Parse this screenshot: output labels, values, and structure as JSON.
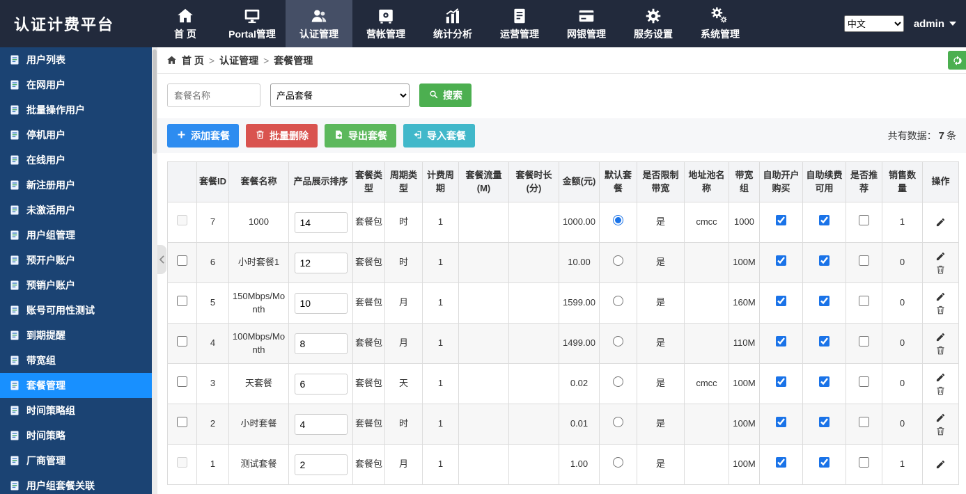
{
  "app": {
    "logo": "认证计费平台"
  },
  "topnav": {
    "items": [
      {
        "label": "首 页",
        "icon": "home-icon",
        "active": false
      },
      {
        "label": "Portal管理",
        "icon": "monitor-icon",
        "active": false
      },
      {
        "label": "认证管理",
        "icon": "users-icon",
        "active": true
      },
      {
        "label": "营帐管理",
        "icon": "safe-icon",
        "active": false
      },
      {
        "label": "统计分析",
        "icon": "chart-icon",
        "active": false
      },
      {
        "label": "运营管理",
        "icon": "ledger-icon",
        "active": false
      },
      {
        "label": "网银管理",
        "icon": "bankcard-icon",
        "active": false
      },
      {
        "label": "服务设置",
        "icon": "gear-icon",
        "active": false
      },
      {
        "label": "系统管理",
        "icon": "cogs-icon",
        "active": false
      }
    ],
    "language_selected": "中文",
    "username": "admin"
  },
  "sidebar": {
    "items": [
      {
        "label": "用户列表",
        "active": false
      },
      {
        "label": "在网用户",
        "active": false
      },
      {
        "label": "批量操作用户",
        "active": false
      },
      {
        "label": "停机用户",
        "active": false
      },
      {
        "label": "在线用户",
        "active": false
      },
      {
        "label": "新注册用户",
        "active": false
      },
      {
        "label": "未激活用户",
        "active": false
      },
      {
        "label": "用户组管理",
        "active": false
      },
      {
        "label": "预开户账户",
        "active": false
      },
      {
        "label": "预销户账户",
        "active": false
      },
      {
        "label": "账号可用性测试",
        "active": false
      },
      {
        "label": "到期提醒",
        "active": false
      },
      {
        "label": "带宽组",
        "active": false
      },
      {
        "label": "套餐管理",
        "active": true
      },
      {
        "label": "时间策略组",
        "active": false
      },
      {
        "label": "时间策略",
        "active": false
      },
      {
        "label": "厂商管理",
        "active": false
      },
      {
        "label": "用户组套餐关联",
        "active": false
      }
    ]
  },
  "breadcrumb": {
    "separator": ">",
    "items": [
      "首 页",
      "认证管理",
      "套餐管理"
    ]
  },
  "filters": {
    "name_placeholder": "套餐名称",
    "type_selected": "产品套餐",
    "search_label": "搜索"
  },
  "toolbar": {
    "add_label": "添加套餐",
    "batch_delete_label": "批量删除",
    "export_label": "导出套餐",
    "import_label": "导入套餐",
    "count_prefix": "共有数据：",
    "count": "7",
    "count_suffix": "条"
  },
  "table": {
    "headers": [
      "套餐ID",
      "套餐名称",
      "产品展示排序",
      "套餐类型",
      "周期类型",
      "计费周期",
      "套餐流量(M)",
      "套餐时长(分)",
      "金额(元)",
      "默认套餐",
      "是否限制带宽",
      "地址池名称",
      "带宽组",
      "自助开户购买",
      "自助续费可用",
      "是否推荐",
      "销售数量",
      "操作"
    ],
    "rows": [
      {
        "id": "7",
        "name": "1000",
        "sort": "14",
        "type": "套餐包",
        "period_type": "时",
        "billing_period": "1",
        "flow": "",
        "duration": "",
        "amount": "1000.00",
        "is_default": true,
        "limit_bandwidth": "是",
        "pool": "cmcc",
        "bandwidth_group": "1000",
        "self_purchase": true,
        "self_renew": true,
        "recommend": false,
        "sales": "1",
        "checkbox_disabled": true,
        "can_delete": false
      },
      {
        "id": "6",
        "name": "小时套餐1",
        "sort": "12",
        "type": "套餐包",
        "period_type": "时",
        "billing_period": "1",
        "flow": "",
        "duration": "",
        "amount": "10.00",
        "is_default": false,
        "limit_bandwidth": "是",
        "pool": "",
        "bandwidth_group": "100M",
        "self_purchase": true,
        "self_renew": true,
        "recommend": false,
        "sales": "0",
        "checkbox_disabled": false,
        "can_delete": true
      },
      {
        "id": "5",
        "name": "150Mbps/Month",
        "sort": "10",
        "type": "套餐包",
        "period_type": "月",
        "billing_period": "1",
        "flow": "",
        "duration": "",
        "amount": "1599.00",
        "is_default": false,
        "limit_bandwidth": "是",
        "pool": "",
        "bandwidth_group": "160M",
        "self_purchase": true,
        "self_renew": true,
        "recommend": false,
        "sales": "0",
        "checkbox_disabled": false,
        "can_delete": true
      },
      {
        "id": "4",
        "name": "100Mbps/Month",
        "sort": "8",
        "type": "套餐包",
        "period_type": "月",
        "billing_period": "1",
        "flow": "",
        "duration": "",
        "amount": "1499.00",
        "is_default": false,
        "limit_bandwidth": "是",
        "pool": "",
        "bandwidth_group": "110M",
        "self_purchase": true,
        "self_renew": true,
        "recommend": false,
        "sales": "0",
        "checkbox_disabled": false,
        "can_delete": true
      },
      {
        "id": "3",
        "name": "天套餐",
        "sort": "6",
        "type": "套餐包",
        "period_type": "天",
        "billing_period": "1",
        "flow": "",
        "duration": "",
        "amount": "0.02",
        "is_default": false,
        "limit_bandwidth": "是",
        "pool": "cmcc",
        "bandwidth_group": "100M",
        "self_purchase": true,
        "self_renew": true,
        "recommend": false,
        "sales": "0",
        "checkbox_disabled": false,
        "can_delete": true
      },
      {
        "id": "2",
        "name": "小时套餐",
        "sort": "4",
        "type": "套餐包",
        "period_type": "时",
        "billing_period": "1",
        "flow": "",
        "duration": "",
        "amount": "0.01",
        "is_default": false,
        "limit_bandwidth": "是",
        "pool": "",
        "bandwidth_group": "100M",
        "self_purchase": true,
        "self_renew": true,
        "recommend": false,
        "sales": "0",
        "checkbox_disabled": false,
        "can_delete": true
      },
      {
        "id": "1",
        "name": "测试套餐",
        "sort": "2",
        "type": "套餐包",
        "period_type": "月",
        "billing_period": "1",
        "flow": "",
        "duration": "",
        "amount": "1.00",
        "is_default": false,
        "limit_bandwidth": "是",
        "pool": "",
        "bandwidth_group": "100M",
        "self_purchase": true,
        "self_renew": true,
        "recommend": false,
        "sales": "1",
        "checkbox_disabled": true,
        "can_delete": false
      }
    ]
  }
}
